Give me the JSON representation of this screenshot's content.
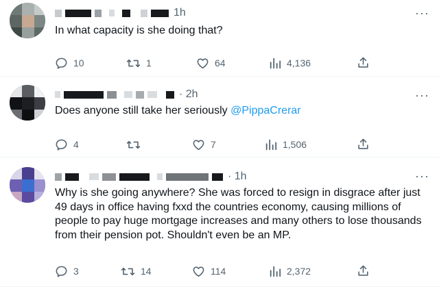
{
  "tweets": [
    {
      "time": "1h",
      "text": "In what capacity is she doing that?",
      "mention": "",
      "replies": "10",
      "retweets": "1",
      "likes": "64",
      "views": "4,136"
    },
    {
      "time": "· 2h",
      "text": "Does anyone still take her seriously ",
      "mention": "@PippaCrerar",
      "replies": "4",
      "retweets": "",
      "likes": "7",
      "views": "1,506"
    },
    {
      "time": "· 1h",
      "text": "Why is she going anywhere? She was forced to resign in disgrace after just 49 days in office having fxxd the countries economy,  causing millions of people to pay huge mortgage increases and many others to lose thousands from their pension pot. Shouldn't even be an MP.",
      "mention": "",
      "replies": "3",
      "retweets": "14",
      "likes": "114",
      "views": "2,372"
    }
  ],
  "icons": {
    "reply": "reply-icon",
    "retweet": "retweet-icon",
    "like": "heart-icon",
    "views": "views-chart-icon",
    "share": "share-icon",
    "more": "more-icon"
  },
  "more_glyph": "···"
}
